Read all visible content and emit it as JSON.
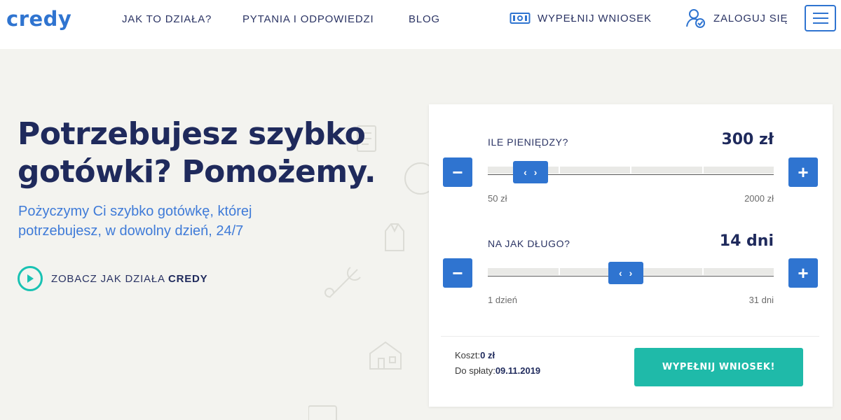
{
  "header": {
    "logo": "credy",
    "nav": [
      "JAK TO DZIAŁA?",
      "PYTANIA I ODPOWIEDZI",
      "BLOG"
    ],
    "apply_label": "WYPEŁNIJ WNIOSEK",
    "login_label": "ZALOGUJ SIĘ",
    "icons": {
      "apply": "banknote-icon",
      "login": "user-check-icon",
      "menu": "hamburger-menu-icon"
    }
  },
  "hero": {
    "title_line1": "Potrzebujesz szybko",
    "title_line2": "gotówki? Pomożemy.",
    "subtitle_line1": "Pożyczymy Ci szybko gotówkę, której",
    "subtitle_line2": "potrzebujesz, w dowolny dzień, 24/7",
    "video_text": "ZOBACZ JAK DZIAŁA",
    "video_brand": "CREDY"
  },
  "calculator": {
    "amount": {
      "label": "ILE PIENIĘDZY?",
      "value": "300 zł",
      "min_label": "50 zł",
      "max_label": "2000 zł",
      "position_fraction": 0.1
    },
    "duration": {
      "label": "NA JAK DŁUGO?",
      "value": "14 dni",
      "min_label": "1 dzień",
      "max_label": "31 dni",
      "position_fraction": 0.433
    },
    "minus_symbol": "−",
    "plus_symbol": "+",
    "cost_label": "Koszt:",
    "cost_value": "0 zł",
    "due_label": "Do spłaty:",
    "due_value": "09.11.2019",
    "cta_label": "WYPEŁNIJ WNIOSEK!"
  },
  "colors": {
    "brand_blue": "#2f74d0",
    "navy": "#1f2a5c",
    "teal": "#1fbaa9",
    "background": "#f3f3ef"
  }
}
